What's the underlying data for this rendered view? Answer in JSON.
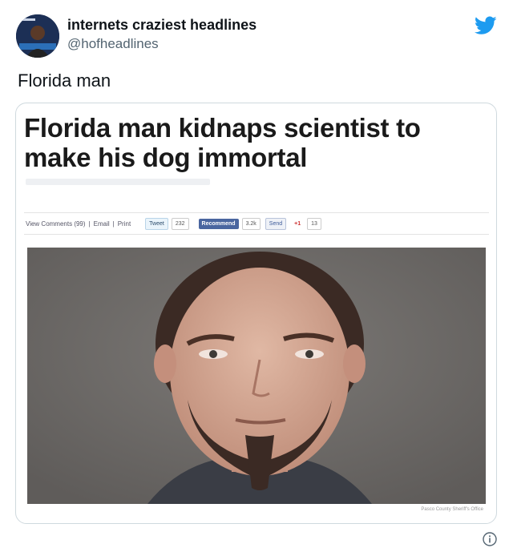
{
  "tweet": {
    "display_name": "internets craziest headlines",
    "handle": "@hofheadlines",
    "text": "Florida man",
    "brand_color": "#1d9bf0"
  },
  "card": {
    "headline": "Florida man kidnaps scientist to make his dog immortal",
    "share_bar": {
      "view_comments": "View Comments (99)",
      "email": "Email",
      "print": "Print",
      "tweet_label": "Tweet",
      "tweet_count": "232",
      "recommend_label": "Recommend",
      "recommend_count": "3.2k",
      "send_label": "Send",
      "gplus_label": "+1",
      "gplus_count": "13"
    },
    "photo_credit": "Pasco County Sheriff's Office"
  },
  "icons": {
    "bird": "twitter-bird-icon",
    "info": "info-icon"
  }
}
